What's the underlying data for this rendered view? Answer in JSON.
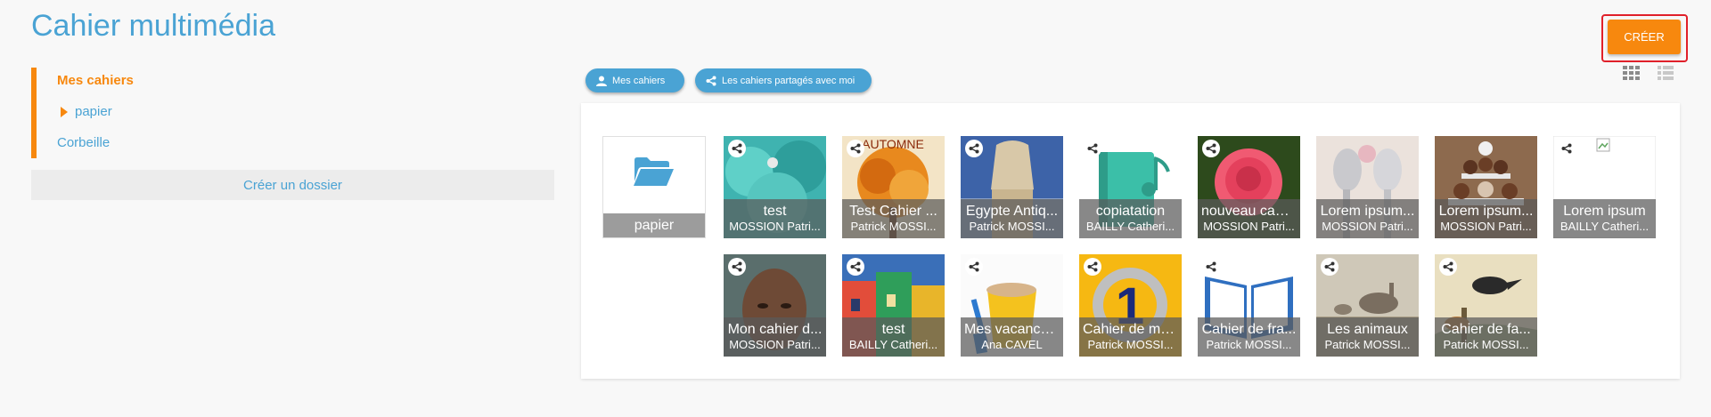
{
  "page": {
    "title": "Cahier multimédia"
  },
  "toolbar": {
    "create_label": "CRÉER"
  },
  "sidebar": {
    "active_label": "Mes cahiers",
    "folder_label": "papier",
    "trash_label": "Corbeille",
    "new_folder_label": "Créer un dossier"
  },
  "tabs": [
    {
      "label": "Mes cahiers",
      "icon": "user-icon"
    },
    {
      "label": "Les cahiers partagés avec moi",
      "icon": "share-icon"
    }
  ],
  "folder": {
    "label": "papier",
    "icon": "folder-open-icon"
  },
  "notebooks": [
    {
      "title": "test",
      "author": "MOSSION Patri...",
      "shared": true,
      "thumb": "teal-cupcakes"
    },
    {
      "title": "Test Cahier ...",
      "author": "Patrick MOSSI...",
      "shared": true,
      "thumb": "autumn-tree"
    },
    {
      "title": "Egypte Antiq...",
      "author": "Patrick MOSSI...",
      "shared": true,
      "thumb": "egypt-statue"
    },
    {
      "title": "copiatation",
      "author": "BAILLY Catheri...",
      "shared": true,
      "thumb": "music-notebook"
    },
    {
      "title": "nouveau cahi...",
      "author": "MOSSION Patri...",
      "shared": true,
      "thumb": "pink-rose"
    },
    {
      "title": "Lorem ipsum...",
      "author": "MOSSION Patri...",
      "shared": false,
      "thumb": "spoons"
    },
    {
      "title": "Lorem ipsum...",
      "author": "MOSSION Patri...",
      "shared": false,
      "thumb": "cupcake-tower"
    },
    {
      "title": "Lorem ipsum",
      "author": "BAILLY Catheri...",
      "shared": true,
      "thumb": "broken-image"
    },
    {
      "title": "Mon cahier d...",
      "author": "MOSSION Patri...",
      "shared": true,
      "thumb": "portrait"
    },
    {
      "title": "test",
      "author": "BAILLY Catheri...",
      "shared": true,
      "thumb": "colorful-houses"
    },
    {
      "title": "Mes vacance...",
      "author": "Ana CAVEL",
      "shared": true,
      "thumb": "sand-bucket"
    },
    {
      "title": "Cahier de ma...",
      "author": "Patrick MOSSI...",
      "shared": true,
      "thumb": "number-one"
    },
    {
      "title": "Cahier de fra...",
      "author": "Patrick MOSSI...",
      "shared": true,
      "thumb": "open-book"
    },
    {
      "title": "Les animaux",
      "author": "Patrick MOSSI...",
      "shared": true,
      "thumb": "geese"
    },
    {
      "title": "Cahier de fa...",
      "author": "Patrick MOSSI...",
      "shared": true,
      "thumb": "fable-crow"
    }
  ],
  "colors": {
    "accent": "#f7880e",
    "primary": "#4aa3d4",
    "highlight": "#e0202a"
  }
}
